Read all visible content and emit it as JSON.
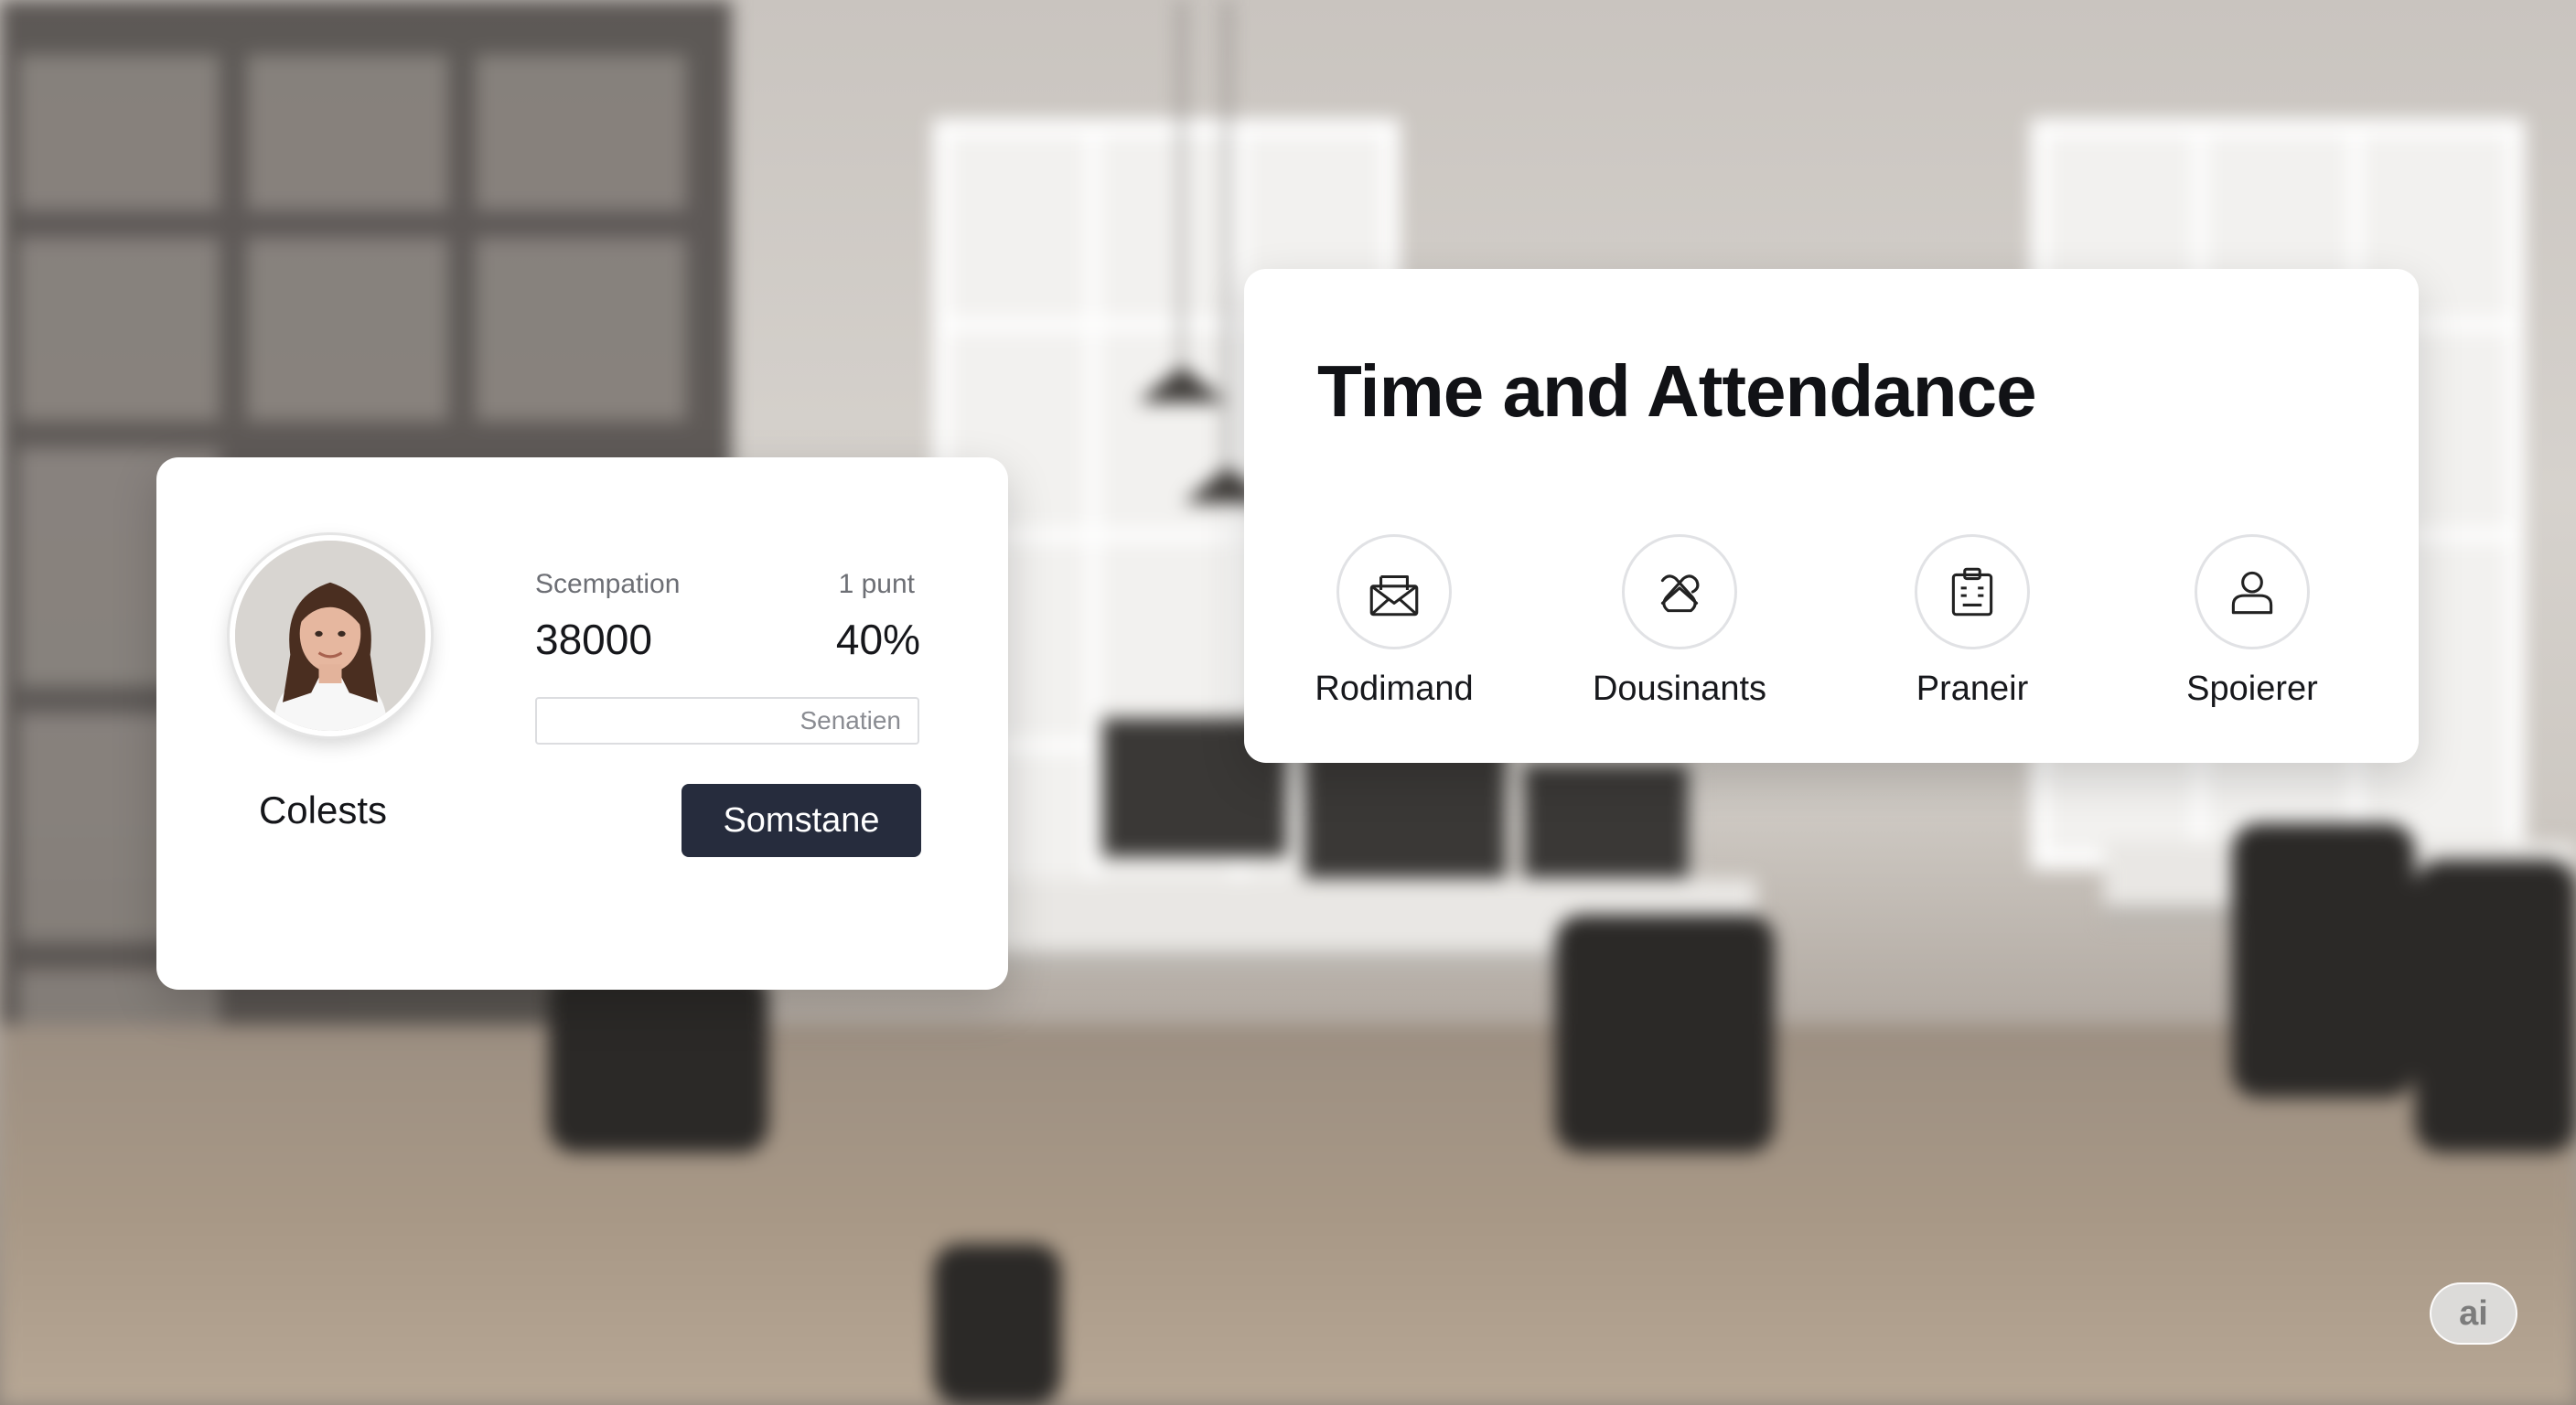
{
  "profile_card": {
    "name": "Colests",
    "stats": [
      {
        "label": "Scempation",
        "value": "38000"
      },
      {
        "label": "1 punt",
        "value": "40%"
      }
    ],
    "input_placeholder": "Senatien",
    "button_label": "Somstane"
  },
  "attendance_card": {
    "title": "Time and Attendance",
    "items": [
      {
        "label": "Rodimand",
        "icon": "envelope-icon"
      },
      {
        "label": "Dousinants",
        "icon": "crossed-envelope-icon"
      },
      {
        "label": "Praneir",
        "icon": "clipboard-icon"
      },
      {
        "label": "Spoierer",
        "icon": "user-icon"
      }
    ]
  },
  "badge": {
    "text": "ai"
  }
}
